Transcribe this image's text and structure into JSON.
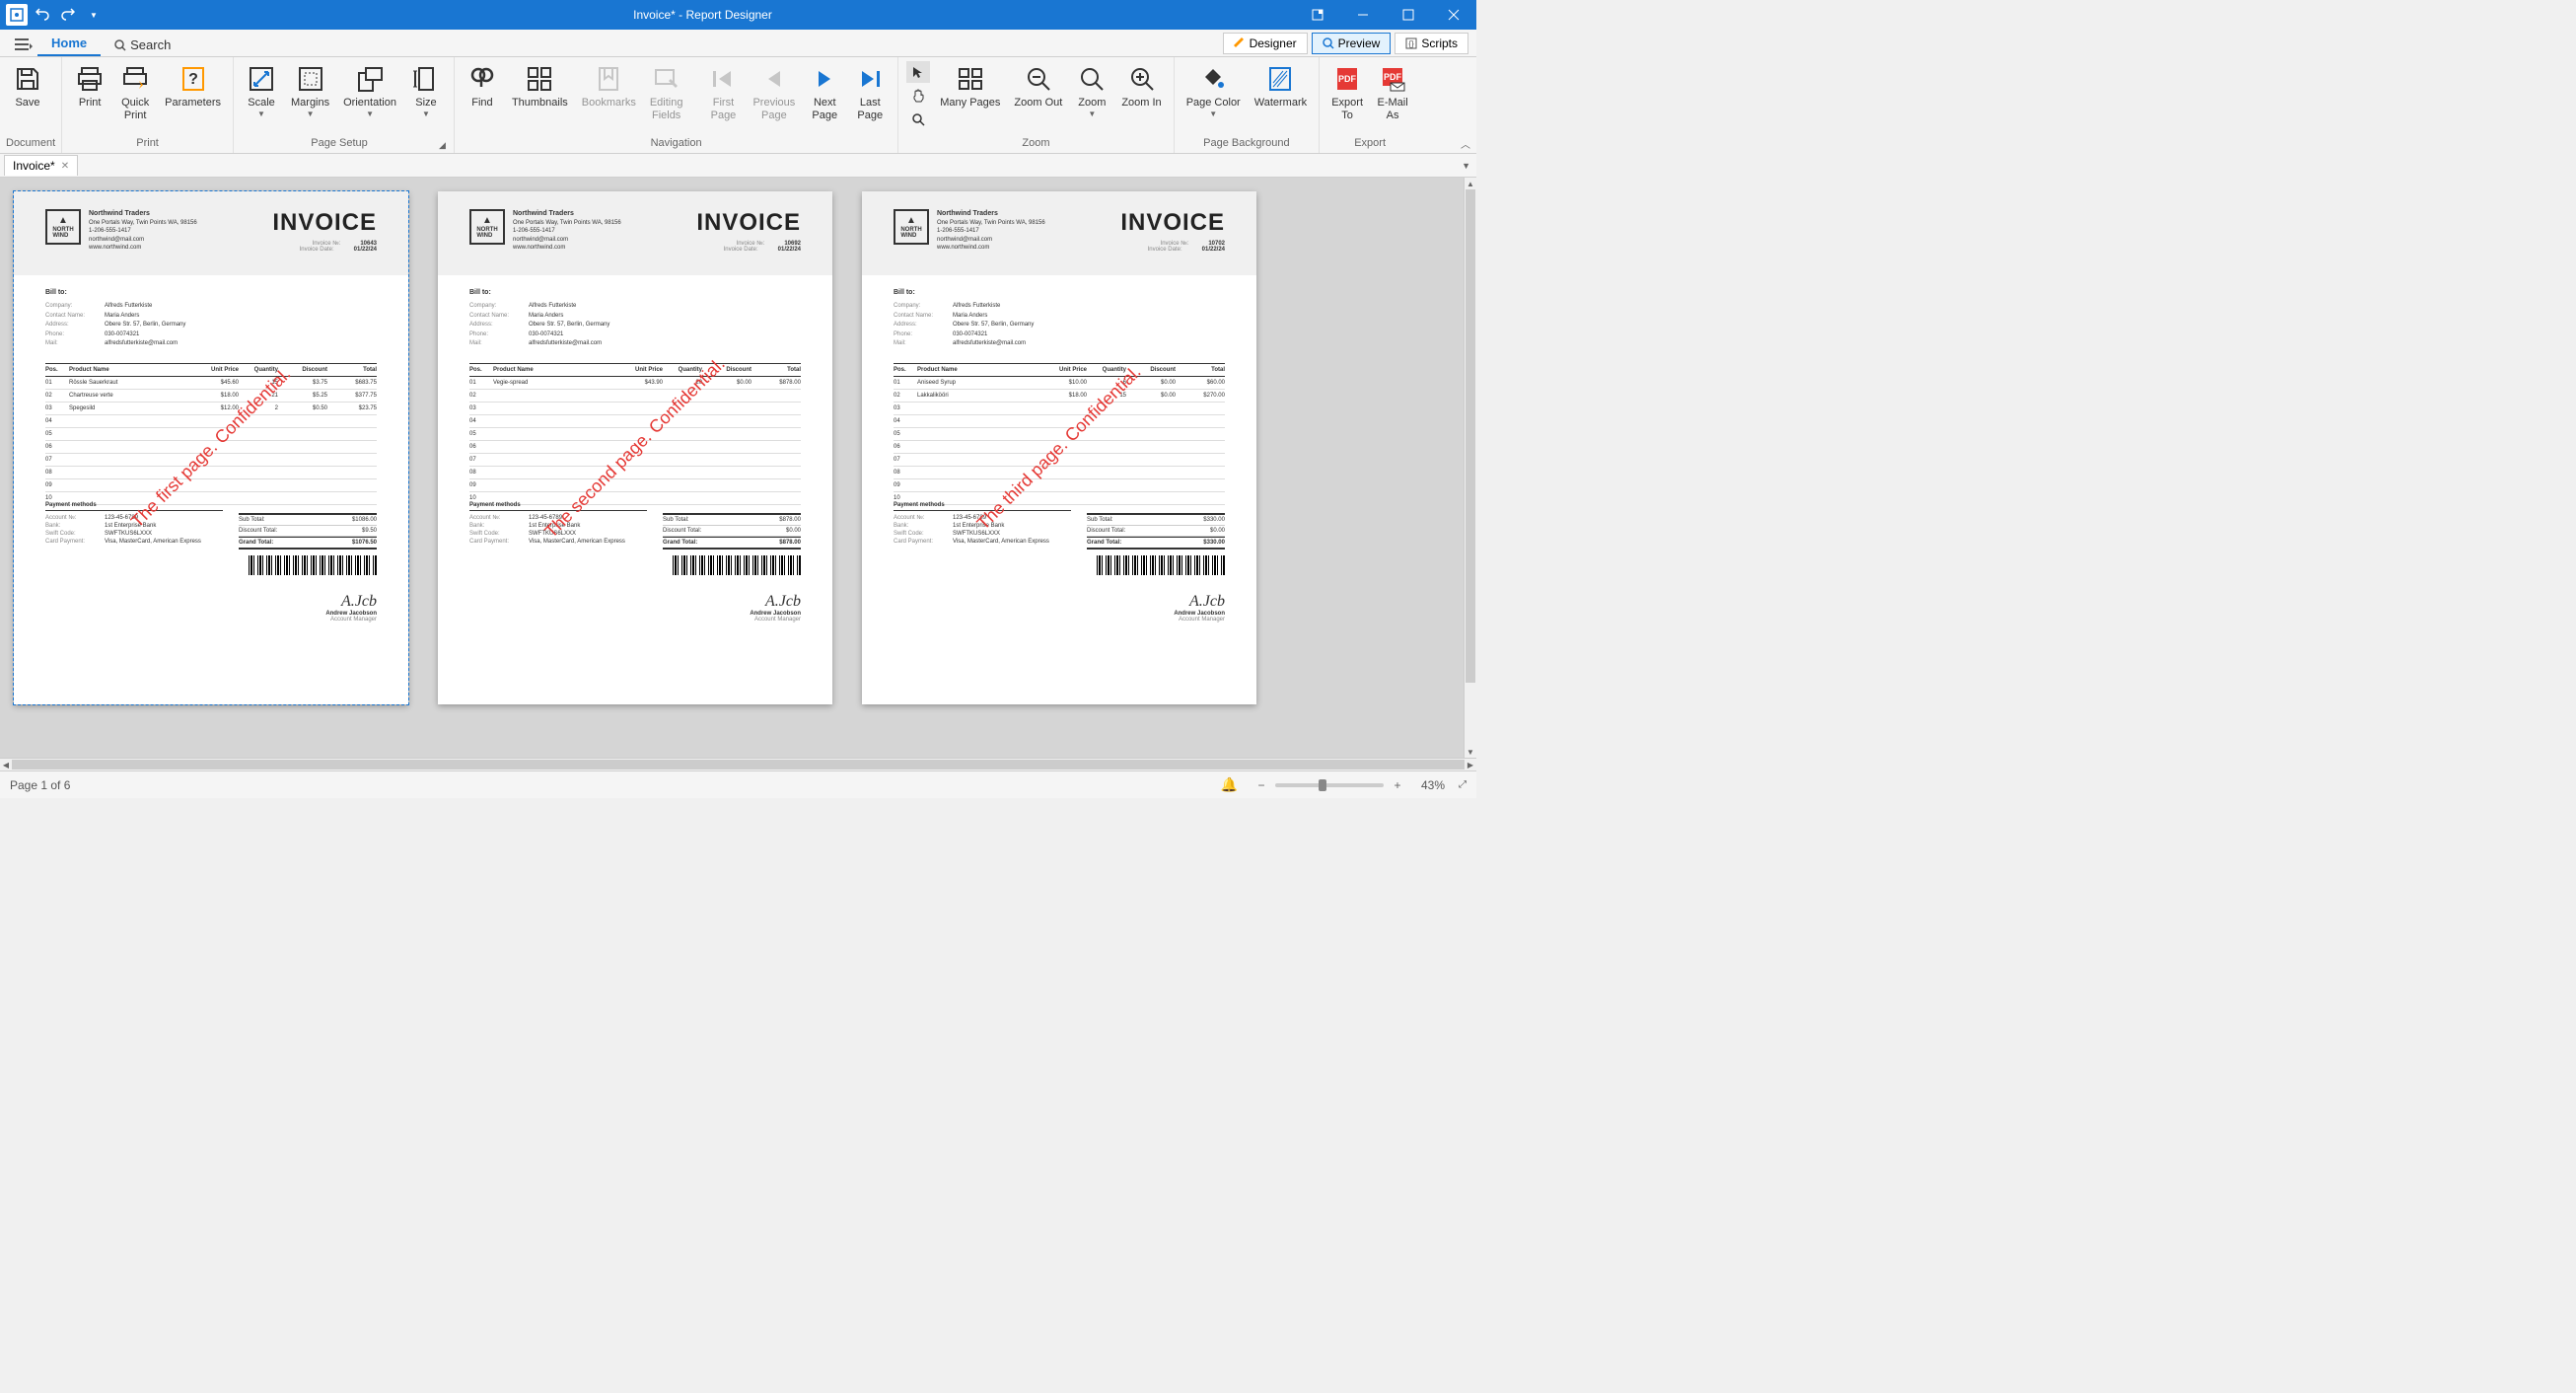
{
  "window": {
    "title": "Invoice* - Report Designer"
  },
  "tabs": {
    "home": "Home",
    "search": "Search"
  },
  "mode_tabs": {
    "designer": "Designer",
    "preview": "Preview",
    "scripts": "Scripts"
  },
  "ribbon": {
    "groups": {
      "document": "Document",
      "print": "Print",
      "page_setup": "Page Setup",
      "navigation": "Navigation",
      "zoom": "Zoom",
      "page_background": "Page Background",
      "export": "Export"
    },
    "buttons": {
      "save": "Save",
      "print": "Print",
      "quick_print": "Quick\nPrint",
      "parameters": "Parameters",
      "scale": "Scale",
      "margins": "Margins",
      "orientation": "Orientation",
      "size": "Size",
      "find": "Find",
      "thumbnails": "Thumbnails",
      "bookmarks": "Bookmarks",
      "editing_fields": "Editing\nFields",
      "first_page": "First\nPage",
      "previous_page": "Previous\nPage",
      "next_page": "Next\nPage",
      "last_page": "Last\nPage",
      "many_pages": "Many Pages",
      "zoom_out": "Zoom Out",
      "zoom": "Zoom",
      "zoom_in": "Zoom In",
      "page_color": "Page Color",
      "watermark": "Watermark",
      "export_to": "Export\nTo",
      "email_as": "E-Mail\nAs"
    }
  },
  "doc_tab": "Invoice*",
  "company": {
    "logo_top": "NORTH",
    "logo_bottom": "WIND",
    "name": "Northwind Traders",
    "address": "One Portals Way, Twin Points WA, 98156",
    "phone": "1-206-555-1417",
    "email": "northwind@mail.com",
    "website": "www.northwind.com"
  },
  "labels": {
    "invoice": "INVOICE",
    "invoice_no": "Invoice №:",
    "invoice_date": "Invoice Date:",
    "bill_to": "Bill to:",
    "company": "Company:",
    "contact": "Contact Name:",
    "address": "Address:",
    "phone": "Phone:",
    "mail": "Mail:",
    "pos": "Pos.",
    "product": "Product Name",
    "unit_price": "Unit Price",
    "quantity": "Quantity",
    "discount": "Discount",
    "total": "Total",
    "sub_total": "Sub Total:",
    "discount_total": "Discount Total:",
    "grand_total": "Grand Total:",
    "payment_methods": "Payment methods",
    "account_no": "Account №:",
    "bank": "Bank:",
    "swift": "Swift Code:",
    "card": "Card Payment:",
    "sig_name": "Andrew Jacobson",
    "sig_title": "Account Manager"
  },
  "bill_to": {
    "company": "Alfreds Futterkiste",
    "contact": "Maria Anders",
    "address": "Obere Str. 57, Berlin, Germany",
    "phone": "030-0074321",
    "mail": "alfredsfutterkiste@mail.com"
  },
  "payment": {
    "account": "123-45-6789",
    "bank": "1st Enterprise Bank",
    "swift": "SWFTKUS6LXXX",
    "card": "Visa, MasterCard, American Express"
  },
  "invoices": [
    {
      "no": "10643",
      "date": "01/22/24",
      "watermark": "The first page. Confidential.",
      "items": [
        {
          "pos": "01",
          "name": "Rössle Sauerkraut",
          "price": "$45.60",
          "qty": "15",
          "disc": "$3.75",
          "total": "$683.75"
        },
        {
          "pos": "02",
          "name": "Chartreuse verte",
          "price": "$18.00",
          "qty": "21",
          "disc": "$5.25",
          "total": "$377.75"
        },
        {
          "pos": "03",
          "name": "Spegesild",
          "price": "$12.00",
          "qty": "2",
          "disc": "$0.50",
          "total": "$23.75"
        },
        {
          "pos": "04"
        },
        {
          "pos": "05"
        },
        {
          "pos": "06"
        },
        {
          "pos": "07"
        },
        {
          "pos": "08"
        },
        {
          "pos": "09"
        },
        {
          "pos": "10"
        }
      ],
      "sub_total": "$1086.00",
      "discount_total": "$9.50",
      "grand_total": "$1076.50"
    },
    {
      "no": "10692",
      "date": "01/22/24",
      "watermark": "The second page. Confidential.",
      "items": [
        {
          "pos": "01",
          "name": "Vegie-spread",
          "price": "$43.90",
          "qty": "20",
          "disc": "$0.00",
          "total": "$878.00"
        },
        {
          "pos": "02"
        },
        {
          "pos": "03"
        },
        {
          "pos": "04"
        },
        {
          "pos": "05"
        },
        {
          "pos": "06"
        },
        {
          "pos": "07"
        },
        {
          "pos": "08"
        },
        {
          "pos": "09"
        },
        {
          "pos": "10"
        }
      ],
      "sub_total": "$878.00",
      "discount_total": "$0.00",
      "grand_total": "$878.00"
    },
    {
      "no": "10702",
      "date": "01/22/24",
      "watermark": "The third page. Confidential.",
      "items": [
        {
          "pos": "01",
          "name": "Aniseed Syrup",
          "price": "$10.00",
          "qty": "6",
          "disc": "$0.00",
          "total": "$60.00"
        },
        {
          "pos": "02",
          "name": "Lakkalikööri",
          "price": "$18.00",
          "qty": "15",
          "disc": "$0.00",
          "total": "$270.00"
        },
        {
          "pos": "03"
        },
        {
          "pos": "04"
        },
        {
          "pos": "05"
        },
        {
          "pos": "06"
        },
        {
          "pos": "07"
        },
        {
          "pos": "08"
        },
        {
          "pos": "09"
        },
        {
          "pos": "10"
        }
      ],
      "sub_total": "$330.00",
      "discount_total": "$0.00",
      "grand_total": "$330.00"
    }
  ],
  "status": {
    "page": "Page 1 of 6",
    "zoom": "43%"
  },
  "signature_script": "A.Jcb"
}
